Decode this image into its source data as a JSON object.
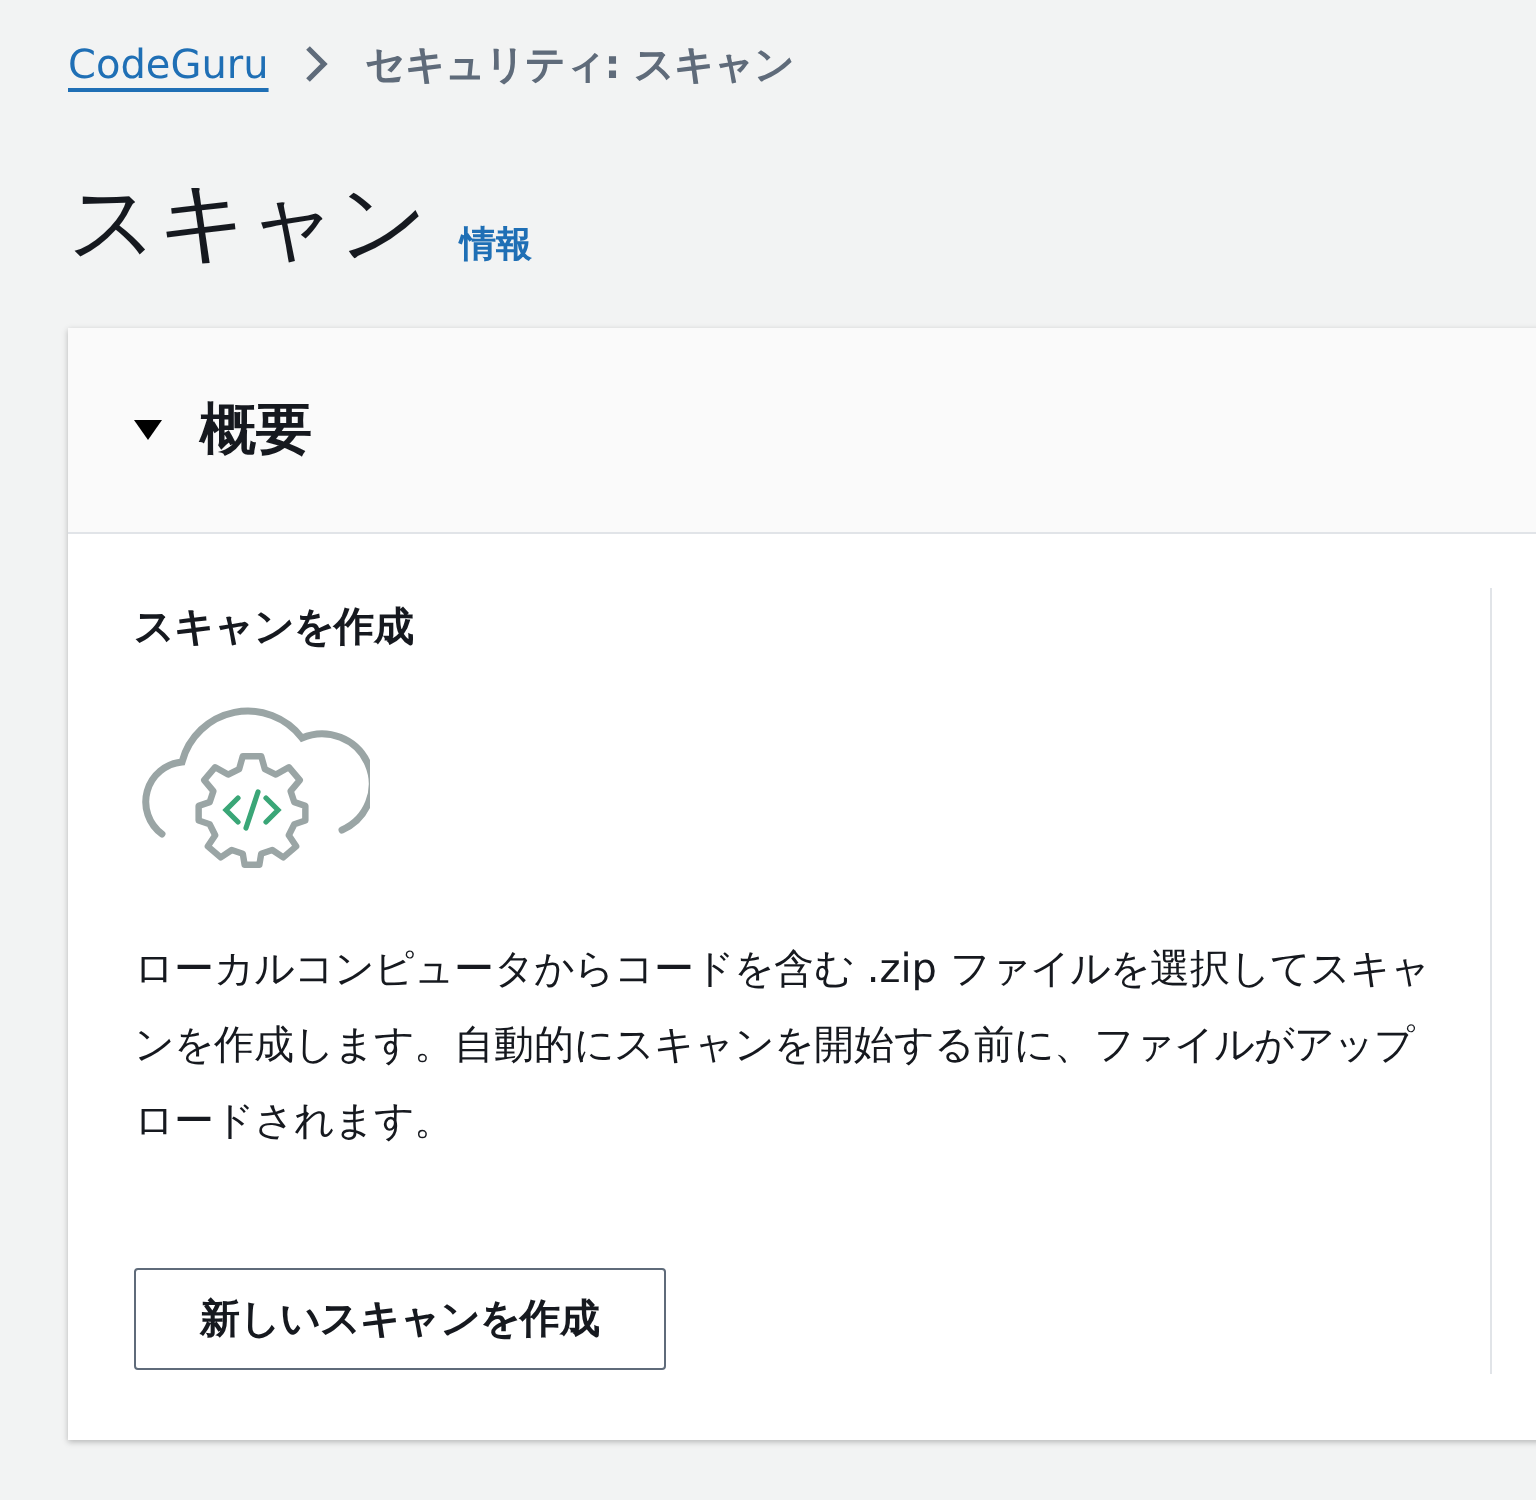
{
  "breadcrumb": [
    {
      "label": "CodeGuru",
      "kind": "link"
    },
    {
      "label": "セキュリティ: スキャン",
      "kind": "current"
    }
  ],
  "page": {
    "title": "スキャン",
    "info_link": "情報"
  },
  "section": {
    "title": "概要",
    "expanded": true,
    "panel": {
      "heading": "スキャンを作成",
      "description": "ローカルコンピュータからコードを含む .zip ファイルを選択してスキャンを作成します。自動的にスキャンを開始する前に、ファイルがアップロードされます。",
      "button": "新しいスキャンを作成"
    }
  }
}
